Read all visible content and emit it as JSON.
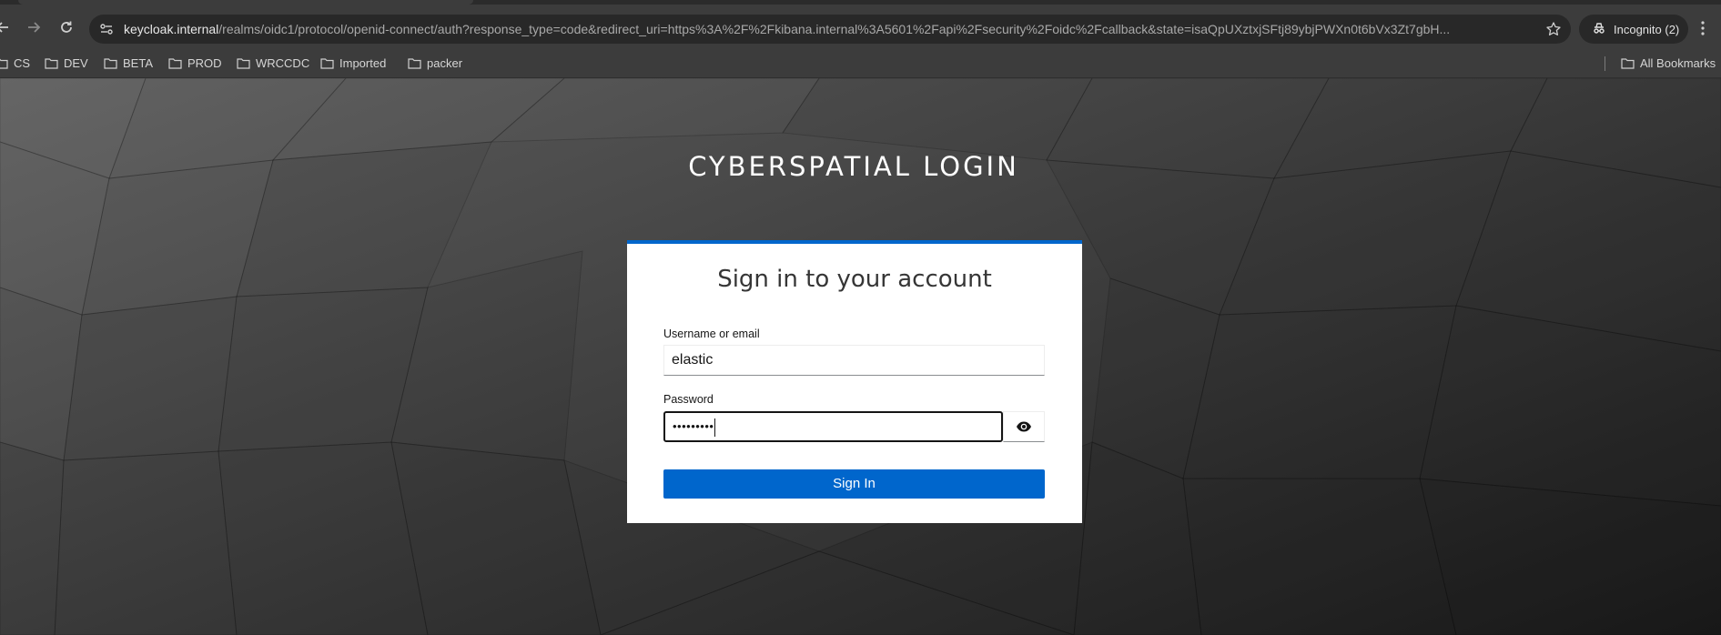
{
  "browser": {
    "url_host": "keycloak.internal",
    "url_path": "/realms/oidc1/protocol/openid-connect/auth?response_type=code&redirect_uri=https%3A%2F%2Fkibana.internal%3A5601%2Fapi%2Fsecurity%2Foidc%2Fcallback&state=isaQpUXztxjSFtj89ybjPWXn0t6bVx3Zt7gbH...",
    "incognito_label": "Incognito (2)",
    "nav_icons": [
      "back-arrow-icon",
      "forward-arrow-icon",
      "reload-icon"
    ],
    "site_info_icon": "tune-icon",
    "bookmark_star_icon": "star-icon",
    "menu_icon": "vertical-dots-icon"
  },
  "bookmarks": {
    "items": [
      {
        "label": "CS"
      },
      {
        "label": "DEV"
      },
      {
        "label": "BETA"
      },
      {
        "label": "PROD"
      },
      {
        "label": "WRCCDC"
      },
      {
        "label": "Imported"
      },
      {
        "label": "packer"
      }
    ],
    "all_bookmarks_label": "All Bookmarks",
    "folder_icon": "folder-icon"
  },
  "login": {
    "realm_title": "CYBERSPATIAL LOGIN",
    "card_title": "Sign in to your account",
    "username_label": "Username or email",
    "username_value": "elastic",
    "password_label": "Password",
    "password_value": "•••••••••",
    "show_password_icon": "eye-icon",
    "submit_label": "Sign In"
  },
  "colors": {
    "accent": "#0066cc",
    "chrome_bg": "#3c3c3c",
    "omnibox_bg": "#282828"
  }
}
